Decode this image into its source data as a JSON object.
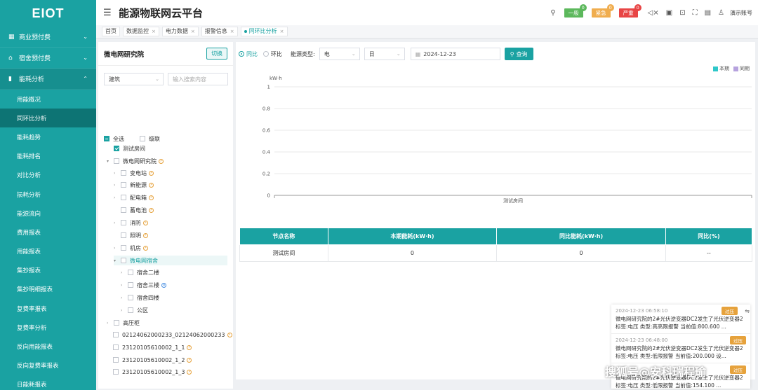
{
  "app": {
    "logo": "EIOT",
    "title": "能源物联网云平台"
  },
  "sidebar": {
    "groups": [
      {
        "label": "商业预付费"
      },
      {
        "label": "宿舍预付费"
      },
      {
        "label": "能耗分析"
      }
    ],
    "items": [
      "用能概况",
      "同环比分析",
      "能耗趋势",
      "能耗排名",
      "对比分析",
      "损耗分析",
      "能源流向",
      "费用报表",
      "用能报表",
      "集抄报表",
      "集抄明细报表",
      "复费率报表",
      "复费率分析",
      "反向用能报表",
      "反向复费率报表",
      "日能耗报表"
    ],
    "active": "同环比分析"
  },
  "header": {
    "alarm_general": "一般",
    "alarm_general_count": "0",
    "alarm_urgent": "紧急",
    "alarm_urgent_count": "0",
    "alarm_severe": "严重",
    "alarm_severe_count": "0",
    "account": "演示账号"
  },
  "tabs": [
    "首页",
    "数据监控",
    "电力数据",
    "报警信息",
    "同环比分析"
  ],
  "tree": {
    "title": "微电网研究院",
    "switch": "切换",
    "building_select": "建筑",
    "search_placeholder": "输入搜索内容",
    "select_all": "全选",
    "cascade": "级联",
    "nodes": [
      "测试房间",
      "微电网研究院",
      "变电站",
      "新能源",
      "配电箱",
      "蓄电池",
      "消防",
      "照明",
      "机房",
      "微电网宿舍",
      "宿舍二楼",
      "宿舍三楼",
      "宿舍四楼",
      "公区",
      "高压柜",
      "02124062000233_02124062000233",
      "23120105610002_1_1",
      "23120105610002_1_2",
      "23120105610002_1_3"
    ]
  },
  "query": {
    "yoy": "同比",
    "mom": "环比",
    "energy_type_label": "能源类型:",
    "energy_type": "电",
    "period": "日",
    "date": "2024-12-23",
    "search": "查询"
  },
  "chart_data": {
    "type": "bar",
    "ylabel": "kW·h",
    "categories": [
      "测试房间"
    ],
    "series": [
      {
        "name": "本期",
        "values": [
          0
        ],
        "color": "#2ec7c9"
      },
      {
        "name": "同期",
        "values": [
          0
        ],
        "color": "#b6a2de"
      }
    ],
    "ylim": [
      0,
      1
    ],
    "yticks": [
      "0",
      "0.2",
      "0.4",
      "0.6",
      "0.8",
      "1"
    ],
    "grid": true,
    "legend": "top-right"
  },
  "table": {
    "headers": [
      "节点名称",
      "本期能耗(kW·h)",
      "同比能耗(kW·h)",
      "同比(%)"
    ],
    "rows": [
      [
        "测试房间",
        "0",
        "0",
        "--"
      ]
    ]
  },
  "notifications": [
    {
      "time": "2024-12-23 06:58:10",
      "tag": "过压",
      "msg": "微电网研究院的2#光伏逆变器DC2发生了光伏逆变器2 标签:电压 类型:高高限报警 当前值:800.600 ..."
    },
    {
      "time": "2024-12-23 06:48:00",
      "tag": "过压",
      "msg": "微电网研究院的2#光伏逆变器DC2发生了光伏逆变器2 标签:电压 类型:低限报警 当前值:200.000 设..."
    },
    {
      "time": "",
      "tag": "过压",
      "msg": "微电网研究院的2#光伏逆变器DC2发生了光伏逆变器2 标签:电压 类型:低限报警 当前值:154.100 ..."
    }
  ],
  "watermark": "搜狐号@安科瑞程瑜"
}
